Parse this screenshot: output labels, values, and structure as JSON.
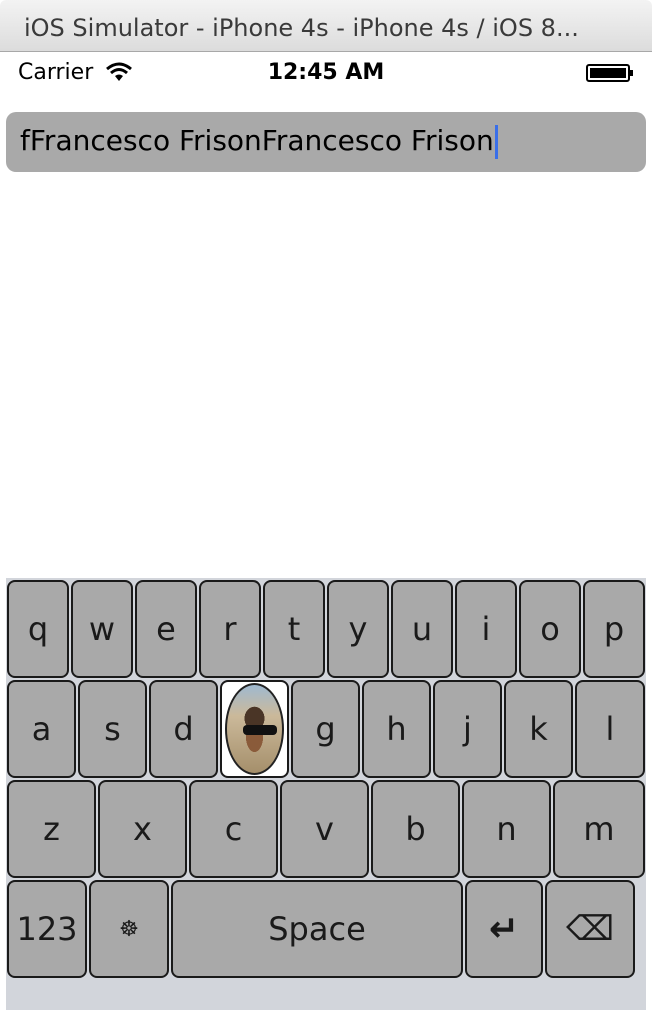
{
  "window": {
    "title": "iOS Simulator - iPhone 4s - iPhone 4s / iOS 8..."
  },
  "status_bar": {
    "carrier": "Carrier",
    "time": "12:45 AM",
    "wifi_icon": "wifi-icon",
    "battery_icon": "battery-icon"
  },
  "text_field": {
    "value": "fFrancesco FrisonFrancesco Frison"
  },
  "keyboard": {
    "row1": [
      "q",
      "w",
      "e",
      "r",
      "t",
      "y",
      "u",
      "i",
      "o",
      "p"
    ],
    "row2": [
      "a",
      "s",
      "d",
      "g",
      "h",
      "j",
      "k",
      "l"
    ],
    "row3": [
      "z",
      "x",
      "c",
      "v",
      "b",
      "n",
      "m"
    ],
    "numbers_label": "123",
    "settings_glyph": "☸",
    "space_label": "Space",
    "return_glyph": "↵",
    "delete_glyph": "⌫",
    "photo_key_icon": "avatar-icon"
  }
}
